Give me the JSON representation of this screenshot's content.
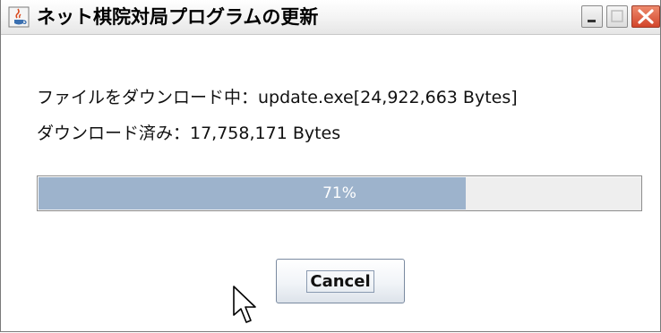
{
  "window": {
    "title": "ネット棋院対局プログラムの更新",
    "app_icon": "java-cup-icon",
    "controls": [
      "minimize-icon",
      "maximize-icon",
      "close-icon"
    ]
  },
  "dialog": {
    "file_line": "ファイルをダウンロード中：update.exe[24,922,663 Bytes]",
    "downloaded_line": "ダウンロード済み：17,758,171 Bytes",
    "progress": {
      "percent": 71,
      "label": "71%"
    },
    "cancel_label": "Cancel"
  },
  "colors": {
    "progress_fill": "#9db3cc",
    "progress_track": "#eeeeee",
    "close_button": "#d2452b"
  }
}
